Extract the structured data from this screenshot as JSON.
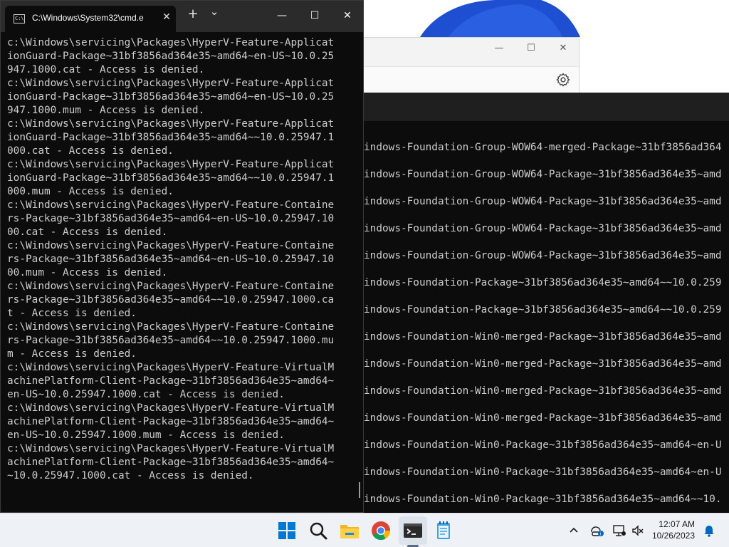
{
  "cmd_window": {
    "tab_title": "C:\\Windows\\System32\\cmd.e",
    "new_tab_symbol": "+",
    "dropdown_symbol": "⌄",
    "close_tab_symbol": "✕",
    "minimize_symbol": "—",
    "maximize_symbol": "☐",
    "close_symbol": "✕",
    "output_lines": [
      "c:\\Windows\\servicing\\Packages\\HyperV-Feature-Applicat",
      "ionGuard-Package~31bf3856ad364e35~amd64~en-US~10.0.25",
      "947.1000.cat - Access is denied.",
      "c:\\Windows\\servicing\\Packages\\HyperV-Feature-Applicat",
      "ionGuard-Package~31bf3856ad364e35~amd64~en-US~10.0.25",
      "947.1000.mum - Access is denied.",
      "c:\\Windows\\servicing\\Packages\\HyperV-Feature-Applicat",
      "ionGuard-Package~31bf3856ad364e35~amd64~~10.0.25947.1",
      "000.cat - Access is denied.",
      "c:\\Windows\\servicing\\Packages\\HyperV-Feature-Applicat",
      "ionGuard-Package~31bf3856ad364e35~amd64~~10.0.25947.1",
      "000.mum - Access is denied.",
      "c:\\Windows\\servicing\\Packages\\HyperV-Feature-Containe",
      "rs-Package~31bf3856ad364e35~amd64~en-US~10.0.25947.10",
      "00.cat - Access is denied.",
      "c:\\Windows\\servicing\\Packages\\HyperV-Feature-Containe",
      "rs-Package~31bf3856ad364e35~amd64~en-US~10.0.25947.10",
      "00.mum - Access is denied.",
      "c:\\Windows\\servicing\\Packages\\HyperV-Feature-Containe",
      "rs-Package~31bf3856ad364e35~amd64~~10.0.25947.1000.ca",
      "t - Access is denied.",
      "c:\\Windows\\servicing\\Packages\\HyperV-Feature-Containe",
      "rs-Package~31bf3856ad364e35~amd64~~10.0.25947.1000.mu",
      "m - Access is denied.",
      "c:\\Windows\\servicing\\Packages\\HyperV-Feature-VirtualM",
      "achinePlatform-Client-Package~31bf3856ad364e35~amd64~",
      "en-US~10.0.25947.1000.cat - Access is denied.",
      "c:\\Windows\\servicing\\Packages\\HyperV-Feature-VirtualM",
      "achinePlatform-Client-Package~31bf3856ad364e35~amd64~",
      "en-US~10.0.25947.1000.mum - Access is denied.",
      "c:\\Windows\\servicing\\Packages\\HyperV-Feature-VirtualM",
      "achinePlatform-Client-Package~31bf3856ad364e35~amd64~",
      "~10.0.25947.1000.cat - Access is denied."
    ]
  },
  "settings_window": {
    "minimize_symbol": "—",
    "maximize_symbol": "☐",
    "close_symbol": "✕"
  },
  "background_terminal": {
    "lines": [
      "indows-Foundation-Group-WOW64-merged-Package~31bf3856ad364",
      "indows-Foundation-Group-WOW64-Package~31bf3856ad364e35~amd",
      "indows-Foundation-Group-WOW64-Package~31bf3856ad364e35~amd",
      "indows-Foundation-Group-WOW64-Package~31bf3856ad364e35~amd",
      "indows-Foundation-Group-WOW64-Package~31bf3856ad364e35~amd",
      "indows-Foundation-Package~31bf3856ad364e35~amd64~~10.0.259",
      "indows-Foundation-Package~31bf3856ad364e35~amd64~~10.0.259",
      "indows-Foundation-Win0-merged-Package~31bf3856ad364e35~amd",
      "indows-Foundation-Win0-merged-Package~31bf3856ad364e35~amd",
      "indows-Foundation-Win0-merged-Package~31bf3856ad364e35~amd",
      "indows-Foundation-Win0-merged-Package~31bf3856ad364e35~amd",
      "indows-Foundation-Win0-Package~31bf3856ad364e35~amd64~en-U",
      "indows-Foundation-Win0-Package~31bf3856ad364e35~amd64~en-U",
      "indows-Foundation-Win0-Package~31bf3856ad364e35~amd64~~10."
    ]
  },
  "taskbar": {
    "pinned_icons": [
      "windows-start-icon",
      "search-icon",
      "file-explorer-icon",
      "chrome-icon",
      "terminal-icon",
      "notepad-icon"
    ],
    "tray_icons": [
      "chevron-up-icon",
      "network-info-icon",
      "display-icon",
      "volume-muted-icon",
      "notification-bell-icon"
    ],
    "clock_time": "12:07 AM",
    "clock_date": "10/26/2023"
  },
  "colors": {
    "terminal_bg": "#0c0c0c",
    "terminal_text": "#cccccc",
    "titlebar_bg": "#2b2b2b",
    "taskbar_bg": "#eef1f5",
    "accent_blue": "#0067c0"
  }
}
